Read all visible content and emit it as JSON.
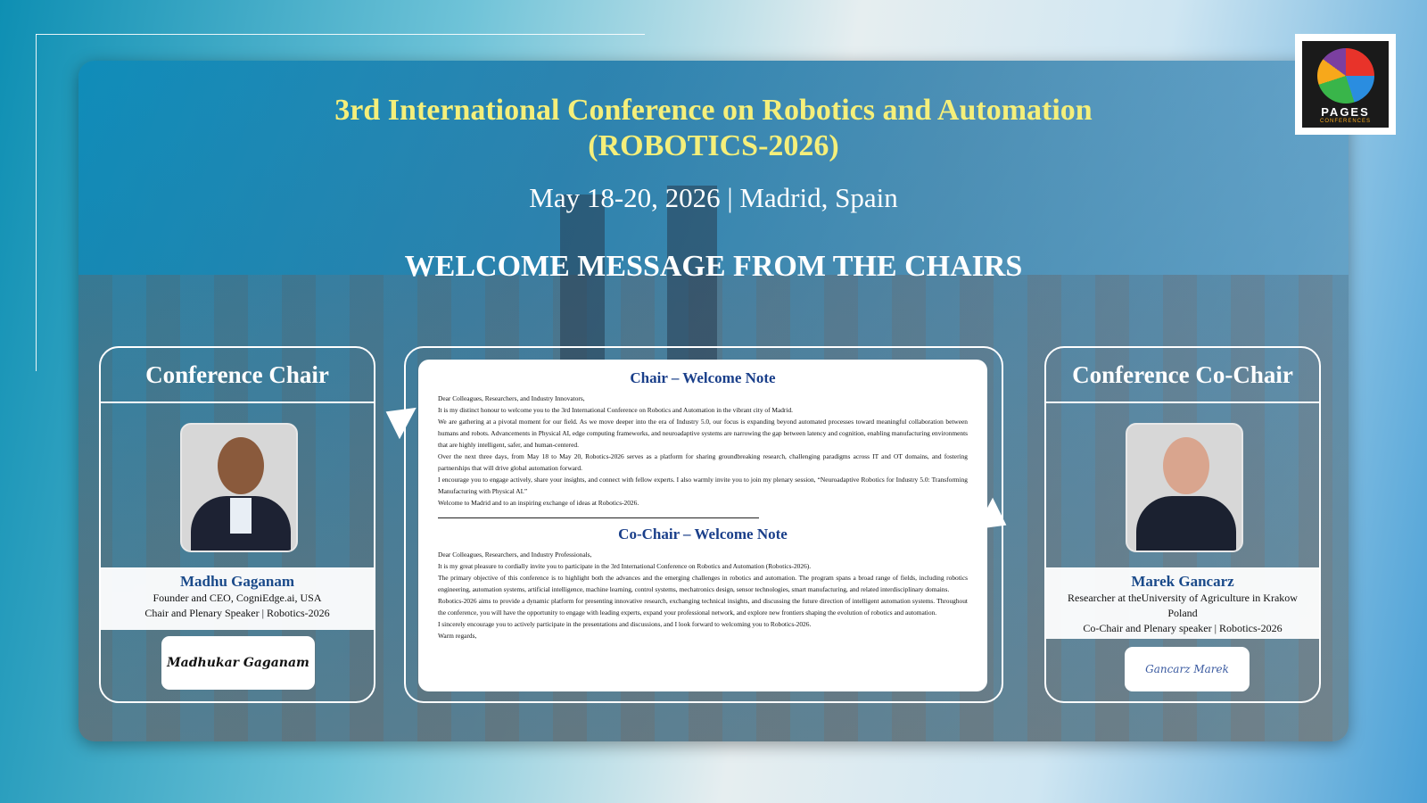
{
  "logo": {
    "text": "PAGES",
    "sub": "CONFERENCES"
  },
  "header": {
    "title_line1": "3rd International Conference on Robotics and Automation",
    "title_line2": "(ROBOTICS-2026)",
    "dates": "May 18-20, 2026 | Madrid, Spain",
    "welcome": "WELCOME MESSAGE FROM THE CHAIRS"
  },
  "chair": {
    "heading": "Conference Chair",
    "name": "Madhu Gaganam",
    "role1": "Founder and CEO, CogniEdge.ai, USA",
    "role2": "Chair and Plenary Speaker | Robotics-2026",
    "signature": "Madhukar Gaganam"
  },
  "cochair": {
    "heading": "Conference Co-Chair",
    "name": "Marek Gancarz",
    "role1": "Researcher at theUniversity of Agriculture in Krakow",
    "role2": "Poland",
    "role3": "Co-Chair and Plenary speaker | Robotics-2026",
    "signature": "Gancarz Marek"
  },
  "notes": {
    "chair_title": "Chair – Welcome Note",
    "chair_paragraphs": [
      "Dear Colleagues, Researchers, and Industry Innovators,",
      "It is my distinct honour to welcome you to the 3rd International Conference on Robotics and Automation in the vibrant city of Madrid.",
      "We are gathering at a pivotal moment for our field. As we move deeper into the era of Industry 5.0, our focus is expanding beyond automated processes toward meaningful collaboration between humans and robots. Advancements in Physical AI, edge computing frameworks, and neuroadaptive systems are narrowing the gap between latency and cognition, enabling manufacturing environments that are highly intelligent, safer, and human-centered.",
      "Over the next three days, from May 18 to May 20, Robotics-2026 serves as a platform for sharing groundbreaking research, challenging paradigms across IT and OT domains, and fostering partnerships that will drive global automation forward.",
      "I encourage you to engage actively, share your insights, and connect with fellow experts. I also warmly invite you to join my plenary session, “Neuroadaptive Robotics for Industry 5.0: Transforming Manufacturing with Physical AI.”",
      "Welcome to Madrid and to an inspiring exchange of ideas at Robotics-2026."
    ],
    "cochair_title": "Co-Chair – Welcome Note",
    "cochair_paragraphs": [
      "Dear Colleagues, Researchers, and Industry Professionals,",
      "It is my great pleasure to cordially invite you to participate in the 3rd International Conference on Robotics and Automation (Robotics-2026).",
      "The primary objective of this conference is to highlight both the advances and the emerging challenges in robotics and automation. The program spans a broad range of fields, including robotics engineering, automation systems, artificial intelligence, machine learning, control systems, mechatronics design, sensor technologies, smart manufacturing, and related interdisciplinary domains.",
      "Robotics-2026 aims to provide a dynamic platform for presenting innovative research, exchanging technical insights, and discussing the future direction of intelligent automation systems. Throughout the conference, you will have the opportunity to engage with leading experts, expand your professional network, and explore new frontiers shaping the evolution of robotics and automation.",
      "I sincerely encourage you to actively participate in the presentations and discussions, and I look forward to welcoming you to Robotics-2026.",
      "Warm regards,"
    ]
  },
  "colors": {
    "title": "#f5ef7a",
    "name": "#1a4a8a",
    "note_title": "#1a3f8a"
  }
}
